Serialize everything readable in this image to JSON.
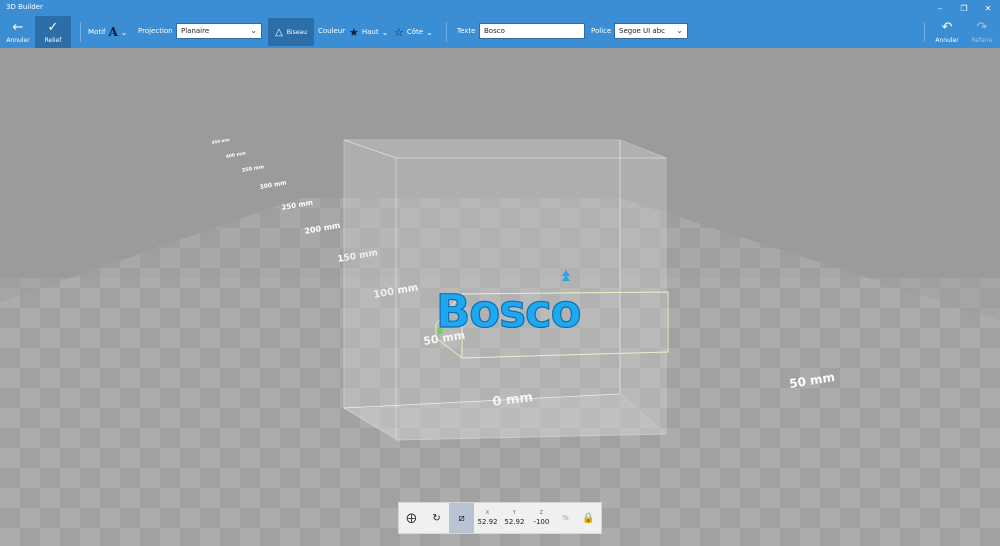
{
  "window": {
    "title": "3D Builder"
  },
  "toolbar": {
    "undo_label": "Annuler",
    "relief_label": "Relief",
    "motif_label": "Motif",
    "projection_label": "Projection",
    "projection_value": "Planaire",
    "biseau_label": "Biseau",
    "couleur_label": "Couleur",
    "haut_label": "Haut",
    "cote_label": "Côte",
    "texte_label": "Texte",
    "texte_value": "Bosco",
    "police_label": "Police",
    "police_value": "Segoe UI  abc",
    "annuler_right_label": "Annuler",
    "refaire_label": "Refaire"
  },
  "viewport": {
    "model_text": "Bosco",
    "ruler_labels": [
      "0 mm",
      "50 mm",
      "100 mm",
      "150 mm",
      "200 mm",
      "250 mm",
      "300 mm",
      "350 mm",
      "400 mm",
      "450 mm"
    ],
    "side_ruler_label": "50 mm",
    "text_color": "#1ea8f0"
  },
  "bottom": {
    "x_axis": "X",
    "y_axis": "Y",
    "z_axis": "Z",
    "x_value": "52.92",
    "y_value": "52.92",
    "z_value": "-100",
    "percent": "%"
  }
}
